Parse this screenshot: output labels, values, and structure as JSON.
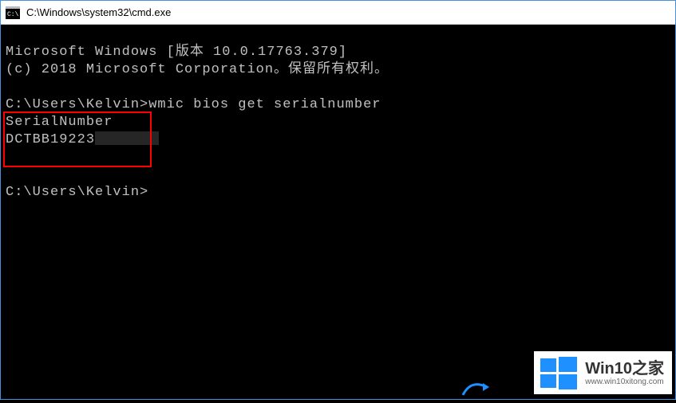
{
  "window": {
    "title": "C:\\Windows\\system32\\cmd.exe"
  },
  "terminal": {
    "banner_line1": "Microsoft Windows [版本 10.0.17763.379]",
    "banner_line2": "(c) 2018 Microsoft Corporation。保留所有权利。",
    "prompt1_path": "C:\\Users\\Kelvin>",
    "command1": "wmic bios get serialnumber",
    "output_header": "SerialNumber",
    "output_value_visible": "DCTBB19223",
    "prompt2_path": "C:\\Users\\Kelvin>"
  },
  "watermark": {
    "main": "Win10之家",
    "sub": "www.win10xitong.com"
  }
}
